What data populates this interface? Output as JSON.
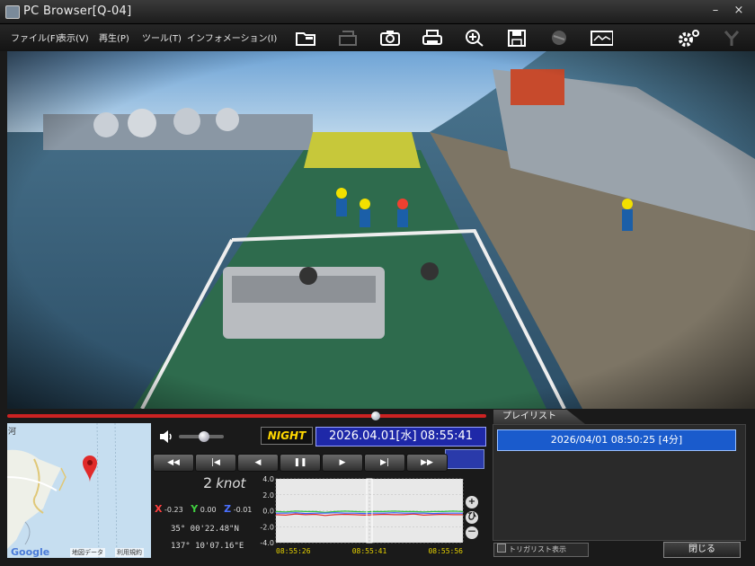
{
  "window": {
    "title": "PC Browser[Q-04]",
    "minimize": "–",
    "close": "×"
  },
  "menu": [
    {
      "label": "ファイル(F)"
    },
    {
      "label": "表示(V)"
    },
    {
      "label": "再生(P)"
    },
    {
      "label": "ツール(T)"
    },
    {
      "label": "インフォメーション(I)"
    }
  ],
  "toolbar_icons": [
    "folder-icon",
    "print-disabled-icon",
    "camera-icon",
    "printer-icon",
    "zoom-icon",
    "save-icon",
    "disabled-icon",
    "monitor-icon",
    "settings-icon",
    "disabled-x-icon"
  ],
  "playback": {
    "progress_percent": 77,
    "night_label": "NIGHT",
    "datetime": "2026.04.01[水] 08:55:41",
    "volume_percent": 55
  },
  "transport": [
    "◀◀",
    "|◀",
    "◀",
    "❚❚",
    "▶",
    "▶|",
    "▶▶"
  ],
  "speed": {
    "value": "2",
    "unit": "knot"
  },
  "accel": {
    "x_label": "X",
    "x_value": "-0.23",
    "y_label": "Y",
    "y_value": "0.00",
    "z_label": "Z",
    "z_value": "-0.01"
  },
  "position": {
    "lat": "35° 00'22.48\"N",
    "lon": "137° 10'07.16\"E"
  },
  "map": {
    "google": "Google",
    "map_data": "地図データ",
    "terms": "利用規約",
    "place": "河"
  },
  "chart_data": {
    "type": "line",
    "ylim": [
      -4.0,
      4.0
    ],
    "yticks": [
      "4.0",
      "2.0",
      "0.0",
      "-2.0",
      "-4.0"
    ],
    "xticks": [
      "08:55:26",
      "08:55:41",
      "08:55:56"
    ],
    "series": [
      {
        "color": "#e03030",
        "values": [
          -0.5,
          -0.55,
          -0.4,
          -0.5,
          -0.45,
          -0.6,
          -0.5,
          -0.45,
          -0.5,
          -0.55,
          -0.5,
          -0.45,
          -0.5,
          -0.5,
          -0.4,
          -0.55,
          -0.5,
          -0.45,
          -0.5,
          -0.5
        ]
      },
      {
        "color": "#30c040",
        "values": [
          -0.1,
          -0.15,
          -0.05,
          -0.1,
          -0.1,
          -0.2,
          -0.1,
          -0.05,
          -0.1,
          -0.15,
          -0.1,
          -0.1,
          -0.05,
          -0.1,
          -0.1,
          -0.15,
          -0.1,
          -0.1,
          -0.05,
          -0.1
        ]
      },
      {
        "color": "#4060ff",
        "values": [
          -0.3,
          -0.3,
          -0.25,
          -0.35,
          -0.3,
          -0.3,
          -0.25,
          -0.3,
          -0.3,
          -0.35,
          -0.3,
          -0.3,
          -0.25,
          -0.3,
          -0.3,
          -0.3,
          -0.35,
          -0.3,
          -0.3,
          -0.3
        ]
      }
    ],
    "cursor_x": "08:55:41"
  },
  "side_buttons": [
    "+",
    "ひ",
    "－"
  ],
  "playlist": {
    "tab": "プレイリスト",
    "items": [
      "2026/04/01 08:50:25 [4分]"
    ],
    "trigger_label": "トリガリスト表示",
    "close_label": "閉じる"
  }
}
